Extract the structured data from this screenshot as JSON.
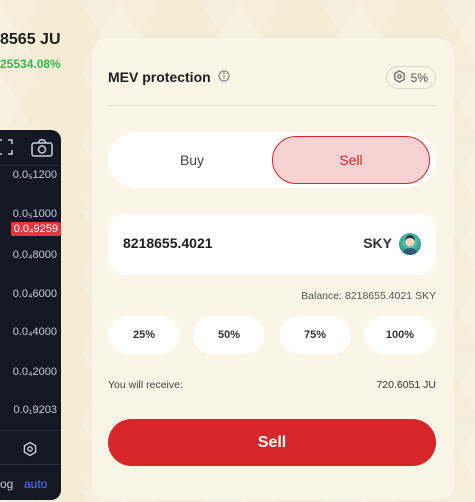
{
  "ticker": {
    "price": "8565 JU",
    "change": "25534.08%"
  },
  "chart": {
    "price_labels": [
      "0.0₅1200",
      "0.0₅1000",
      "0.0₄8000",
      "0.0₄6000",
      "0.0₄4000",
      "0.0₄2000",
      "0.0₁9203"
    ],
    "current_price": "0.0₄9259",
    "log_label": "og",
    "auto_label": "auto",
    "icons": [
      "fullscreen-icon",
      "camera-icon",
      "settings-icon"
    ]
  },
  "mev": {
    "title": "MEV protection",
    "slippage": "5%"
  },
  "toggle": {
    "buy_label": "Buy",
    "sell_label": "Sell",
    "active": "sell"
  },
  "amount": {
    "value": "8218655.4021",
    "token": "SKY"
  },
  "balance": "Balance: 8218655.4021 SKY",
  "percent_buttons": [
    "25%",
    "50%",
    "75%",
    "100%"
  ],
  "receive": {
    "label": "You will receive:",
    "value": "720.6051 JU"
  },
  "action": {
    "label": "Sell"
  },
  "colors": {
    "accent": "#d6262b",
    "accent_light": "#f7d2d2",
    "positive": "#3bb54a",
    "panel_bg": "#fbf5e8",
    "page_bg": "#f5ecd6"
  }
}
